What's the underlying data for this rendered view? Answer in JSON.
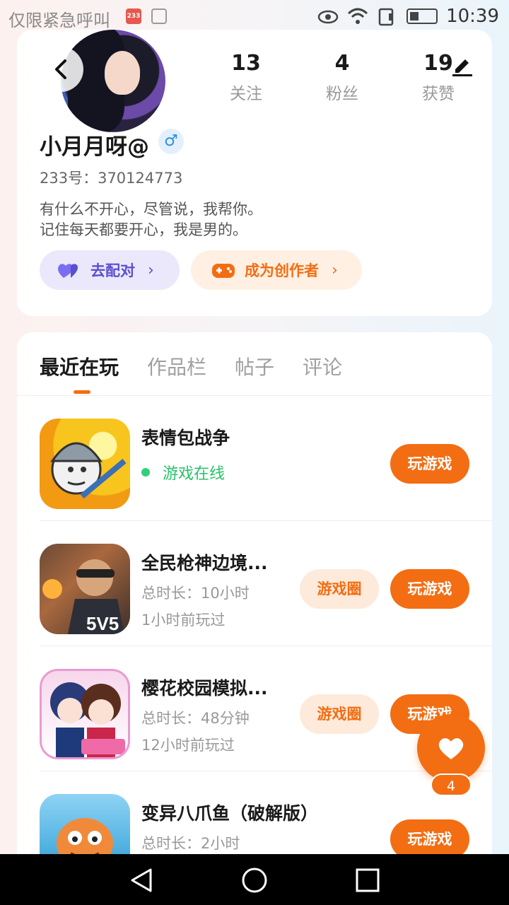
{
  "status_bar": {
    "left_text": "仅限紧急呼叫",
    "app_badge": "233",
    "time": "10:39"
  },
  "profile": {
    "stats": [
      {
        "value": "13",
        "label": "关注"
      },
      {
        "value": "4",
        "label": "粉丝"
      },
      {
        "value": "19",
        "label": "获赞"
      }
    ],
    "nickname": "小月月呀@",
    "gender_symbol": "♂",
    "uid": "233号：370124773",
    "bio_line1": "有什么不开心，尽管说，我帮你。",
    "bio_line2": "记住每天都要开心，我是男的。",
    "match_button": "去配对",
    "creator_button": "成为创作者"
  },
  "tabs": [
    "最近在玩",
    "作品栏",
    "帖子",
    "评论"
  ],
  "games": [
    {
      "title": "表情包战争",
      "status": "游戏在线",
      "play": "玩游戏"
    },
    {
      "title": "全民枪神边境...",
      "duration": "总时长：10小时",
      "last": "1小时前玩过",
      "circle": "游戏圈",
      "play": "玩游戏"
    },
    {
      "title": "樱花校园模拟...",
      "duration": "总时长：48分钟",
      "last": "12小时前玩过",
      "circle": "游戏圈",
      "play": "玩游戏"
    },
    {
      "title": "变异八爪鱼（破解版）",
      "duration": "总时长：2小时",
      "play": "玩游戏"
    }
  ],
  "float_like": {
    "count": "4"
  },
  "colors": {
    "accent": "#f36d12",
    "online": "#28c26a",
    "match": "#5b4fd1"
  }
}
